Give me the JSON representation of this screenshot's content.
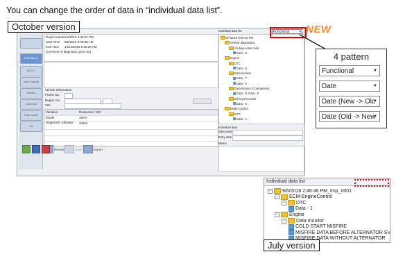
{
  "caption": "You can change the order of data in “individual data list”.",
  "labels": {
    "october": "October version",
    "july": "July version",
    "new_badge": "NEW"
  },
  "main_window": {
    "info_rows": [
      {
        "label": "Project name",
        "value": "9/4/2016 4:48:54 PM"
      },
      {
        "label": "Start Time",
        "value": "9/6/2016 9:48:35 AM"
      },
      {
        "label": "End Time",
        "value": "10/14/2016 9:35:26 AM"
      }
    ],
    "comment_label": "Comment of diagnosis (print out)",
    "nav": {
      "main_menu": "Main Menu",
      "items": [
        "All DTC",
        "Work Support",
        "Monitor",
        "Customize",
        "Data monitor",
        "Util"
      ]
    },
    "vehicle": {
      "title": "Vehicle Information",
      "frame_no": "Frame No.",
      "regist_no": "Regist. No",
      "vin": "VIN"
    },
    "grid": {
      "headers": [
        "Variation",
        "Response / SW"
      ],
      "rows": [
        {
          "c1": "Model",
          "c2": "15MY"
        },
        {
          "c1": "Diagnostic software",
          "c2": "SSMA"
        }
      ]
    },
    "footer_buttons": [
      "Remote",
      "Save",
      "Export"
    ],
    "panel_title": "Individual data list",
    "order_value": "Functional",
    "tree": [
      {
        "text": "9/7/2016 9:00:54 PM",
        "level": 0,
        "kind": "folder"
      },
      {
        "text": "Vehicle diagnostics",
        "level": 1,
        "kind": "folder"
      },
      {
        "text": "All diag-nosis code",
        "level": 2,
        "kind": "folder"
      },
      {
        "text": "Data - 8",
        "level": 3,
        "kind": "leaf"
      },
      {
        "text": "Engine",
        "level": 1,
        "kind": "folder"
      },
      {
        "text": "DTC",
        "level": 2,
        "kind": "folder"
      },
      {
        "text": "Data - 6",
        "level": 3,
        "kind": "leaf"
      },
      {
        "text": "Data monitor",
        "level": 2,
        "kind": "folder"
      },
      {
        "text": "Data - 7",
        "level": 3,
        "kind": "leaf"
      },
      {
        "text": "Data - 5",
        "level": 3,
        "kind": "leaf"
      },
      {
        "text": "Data Monitor (Comparison)",
        "level": 2,
        "kind": "folder"
      },
      {
        "text": "Data - 9, Data - 9",
        "level": 3,
        "kind": "leaf"
      },
      {
        "text": "Driving Recorder",
        "level": 2,
        "kind": "folder"
      },
      {
        "text": "Data - 5",
        "level": 3,
        "kind": "leaf"
      },
      {
        "text": "Brake Control",
        "level": 1,
        "kind": "folder"
      },
      {
        "text": "DTC",
        "level": 2,
        "kind": "folder"
      },
      {
        "text": "Data - 1",
        "level": 3,
        "kind": "leaf"
      }
    ],
    "individual_data": {
      "title": "Individual data",
      "data_name": "Data name",
      "entry_date": "Entry date",
      "memo": "Memo"
    }
  },
  "pattern": {
    "title": "4 pattern",
    "options": [
      "Functional",
      "Date",
      "Date (New -> Olc",
      "Date (Old -> New"
    ]
  },
  "july": {
    "title": "Individual data list",
    "tree": [
      {
        "text": "9/6/2016 2:48:46 PM_Imp_0001",
        "level": 0,
        "kind": "folder",
        "exp": "−"
      },
      {
        "text": "ECM-EngineControl",
        "level": 1,
        "kind": "folder",
        "exp": "−"
      },
      {
        "text": "DTC",
        "level": 2,
        "kind": "folder",
        "exp": "−"
      },
      {
        "text": "Data - 1",
        "level": 3,
        "kind": "leaf",
        "exp": ""
      },
      {
        "text": "Engine",
        "level": 1,
        "kind": "folder",
        "exp": "−"
      },
      {
        "text": "Data monitor",
        "level": 2,
        "kind": "folder",
        "exp": "−"
      },
      {
        "text": "COLD START MISFIRE",
        "level": 3,
        "kind": "leaf",
        "exp": ""
      },
      {
        "text": "MISFIRE DATA BEFORE ALTERNATOR SV",
        "level": 3,
        "kind": "leaf",
        "exp": ""
      },
      {
        "text": "MISFIRE DATA WITHOUT ALTERNATOR",
        "level": 3,
        "kind": "leaf",
        "exp": ""
      }
    ]
  }
}
